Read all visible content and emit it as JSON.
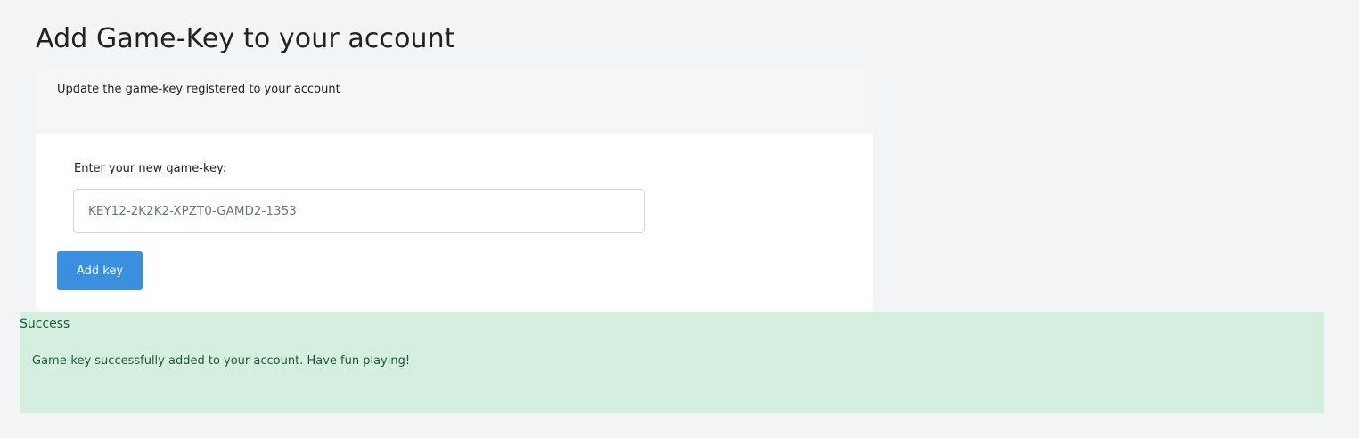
{
  "page": {
    "title": "Add Game-Key to your account"
  },
  "card": {
    "header_text": "Update the game-key registered to your account",
    "field_label": "Enter your new game-key:",
    "input_placeholder": "KEY12-2K2K2-XPZT0-GAMD2-1353",
    "input_value": "",
    "button_label": "Add key"
  },
  "alert": {
    "title": "Success",
    "message": "Game-key successfully added to your account. Have fun playing!"
  },
  "colors": {
    "background": "#f3f4f6",
    "card": "#ffffff",
    "card_header": "#f6f6f6",
    "button": "#3a8fdf",
    "alert_background": "#d4efe0",
    "alert_text": "#1e5a38"
  }
}
